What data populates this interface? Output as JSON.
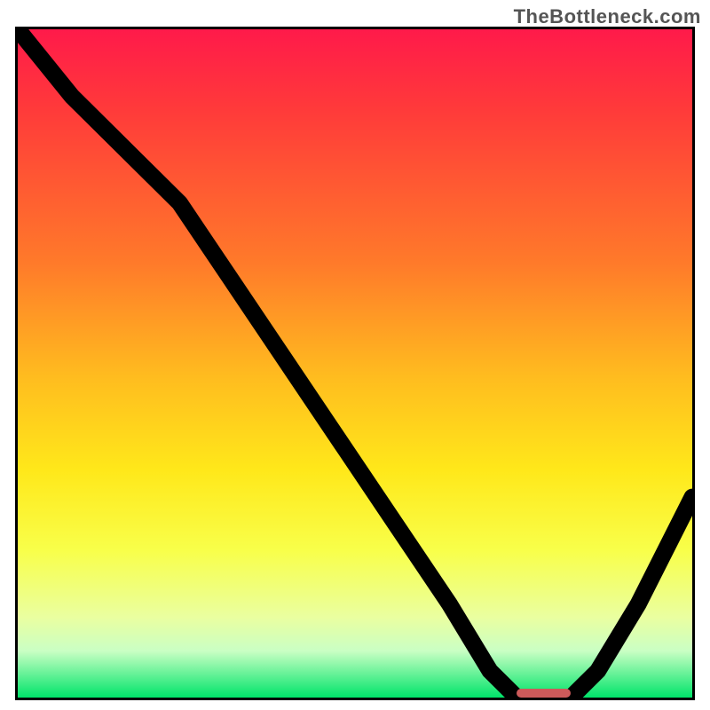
{
  "watermark": "TheBottleneck.com",
  "chart_data": {
    "type": "line",
    "title": "",
    "xlabel": "",
    "ylabel": "",
    "xlim": [
      0,
      100
    ],
    "ylim": [
      0,
      100
    ],
    "grid": false,
    "legend": false,
    "background_gradient": {
      "orientation": "vertical",
      "stops": [
        {
          "pos": 0.0,
          "color": "#ff1a4a"
        },
        {
          "pos": 0.12,
          "color": "#ff3a3a"
        },
        {
          "pos": 0.35,
          "color": "#ff7a2a"
        },
        {
          "pos": 0.52,
          "color": "#ffbc1f"
        },
        {
          "pos": 0.66,
          "color": "#ffe81a"
        },
        {
          "pos": 0.78,
          "color": "#f8ff4a"
        },
        {
          "pos": 0.88,
          "color": "#eaffa0"
        },
        {
          "pos": 0.93,
          "color": "#caffc4"
        },
        {
          "pos": 1.0,
          "color": "#00e46a"
        }
      ]
    },
    "series": [
      {
        "name": "bottleneck-curve",
        "x": [
          0,
          8,
          18,
          24,
          32,
          40,
          48,
          56,
          64,
          70,
          74,
          78,
          82,
          86,
          92,
          100
        ],
        "y": [
          100,
          90,
          80,
          74,
          62,
          50,
          38,
          26,
          14,
          4,
          0,
          0,
          0,
          4,
          14,
          30
        ]
      }
    ],
    "annotations": [
      {
        "name": "optimal-marker",
        "type": "hbar",
        "x_start": 74,
        "x_end": 82,
        "y": 0,
        "color": "#cc5a5a"
      }
    ]
  }
}
